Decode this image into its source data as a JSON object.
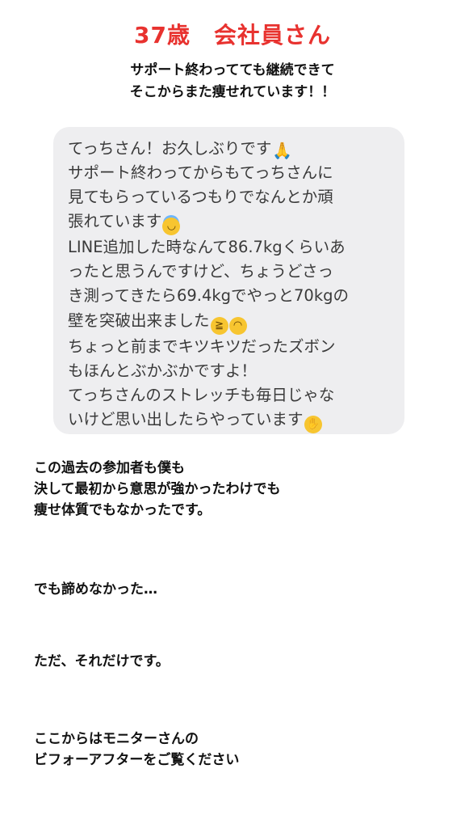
{
  "headline": "37歳　会社員さん",
  "subheadline": {
    "line1": "サポート終わってても継続できて",
    "line2": "そこからまた痩せれています！！"
  },
  "message_bubble": {
    "lines": [
      "てっちさん！お久しぶりです",
      "サポート終わってからもてっちさんに",
      "見てもらっているつもりでなんとか頑",
      "張れています",
      "LINE追加した時なんて86.7kgくらいあ",
      "ったと思うんですけど、ちょうどさっ",
      "き測ってきたら69.4kgでやっと70kgの",
      "壁を突破出来ました",
      "ちょっと前までキツキツだったズボン",
      "もほんとぶかぶかですよ！",
      "てっちさんのストレッチも毎日じゃな",
      "いけど思い出したらやっています"
    ],
    "icons": [
      "folded-hands-emoji",
      "smiling-face-with-halo-emoji",
      "rolling-on-floor-laughing-emoji",
      "face-with-tears-of-joy-emoji",
      "face-with-hand-over-mouth-emoji"
    ],
    "background_color": "#eeeef0"
  },
  "paragraph1": {
    "line1": "この過去の参加者も僕も",
    "line2": "決して最初から意思が強かったわけでも",
    "line3": "痩せ体質でもなかったです。"
  },
  "paragraph2": "でも諦めなかった…",
  "paragraph3": "ただ、それだけです。",
  "paragraph4": {
    "line1": "ここからはモニターさんの",
    "line2": "ビフォーアフターをご覧ください"
  },
  "colors": {
    "headline": "#e8322f",
    "text": "#111111",
    "bubble_text": "#3a3a3a"
  }
}
